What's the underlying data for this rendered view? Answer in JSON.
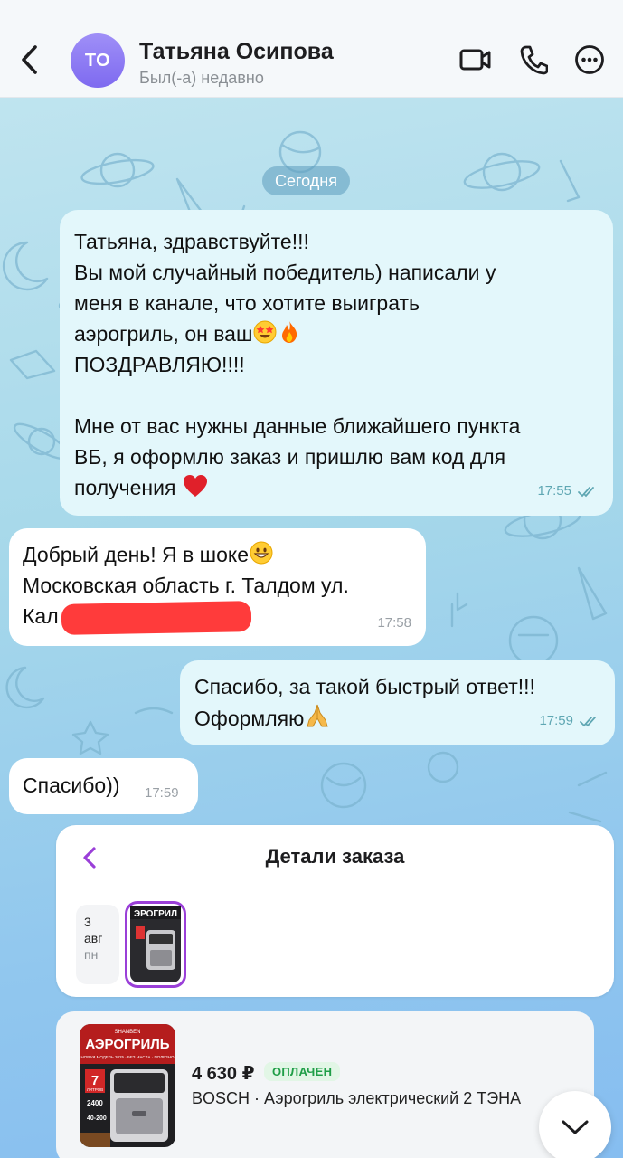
{
  "header": {
    "back_icon": "chevron-left-icon",
    "avatar_initials": "ТО",
    "avatar_color": "#8b7af3",
    "contact_name": "Татьяна Осипова",
    "status": "Был(-а) недавно",
    "icons": [
      "video-call-icon",
      "phone-icon",
      "more-options-icon"
    ]
  },
  "chat": {
    "date_chip": "Сегодня",
    "messages": [
      {
        "direction": "out",
        "lines": [
          "Татьяна, здравствуйте!!!",
          "Вы мой случайный победитель) написали у",
          "меня в канале, что хотите выиграть",
          "аэрогриль, он ваш",
          "ПОЗДРАВЛЯЮ!!!!",
          "",
          "Мне от вас нужны данные ближайшего пункта",
          "ВБ, я оформлю заказ и пришлю вам код для",
          "получения"
        ],
        "emojis": [
          "star-struck-emoji",
          "fire-emoji",
          "red-heart-emoji"
        ],
        "time": "17:55",
        "read": true
      },
      {
        "direction": "in",
        "lines": [
          "Добрый день! Я в шоке",
          "Московская область г. Талдом ул.",
          "Кал"
        ],
        "emojis": [
          "grinning-face-emoji"
        ],
        "redacted": true,
        "time": "17:58"
      },
      {
        "direction": "out",
        "lines": [
          "Спасибо, за такой быстрый ответ!!!",
          "Оформляю"
        ],
        "emojis": [
          "folded-hands-emoji"
        ],
        "time": "17:59",
        "read": true
      },
      {
        "direction": "in",
        "lines": [
          "Спасибо))"
        ],
        "time": "17:59"
      }
    ]
  },
  "order": {
    "title": "Детали заказа",
    "date": {
      "day": "3",
      "month": "авг",
      "weekday": "пн"
    },
    "thumb_label": "ЭРОГРИЛ",
    "accent_color": "#9a3fd8",
    "product": {
      "image_brand": "SHANBEN",
      "image_title": "АЭРОГРИЛЬ",
      "image_subtitle": "НОВАЯ МОДЕЛЬ 2025 · БЕЗ МАСЛА · ПОЛЕЗНО",
      "image_badge_num": "7",
      "image_badge_text": "ЛИТРОВ",
      "image_power": "2400",
      "image_temp": "40-200",
      "price": "4 630 ₽",
      "status": "ОПЛАЧЕН",
      "status_color": "#1f9e47",
      "name": "BOSCH · Аэрогриль электрический 2 ТЭНА"
    }
  },
  "scroll_icon": "chevron-down-icon"
}
